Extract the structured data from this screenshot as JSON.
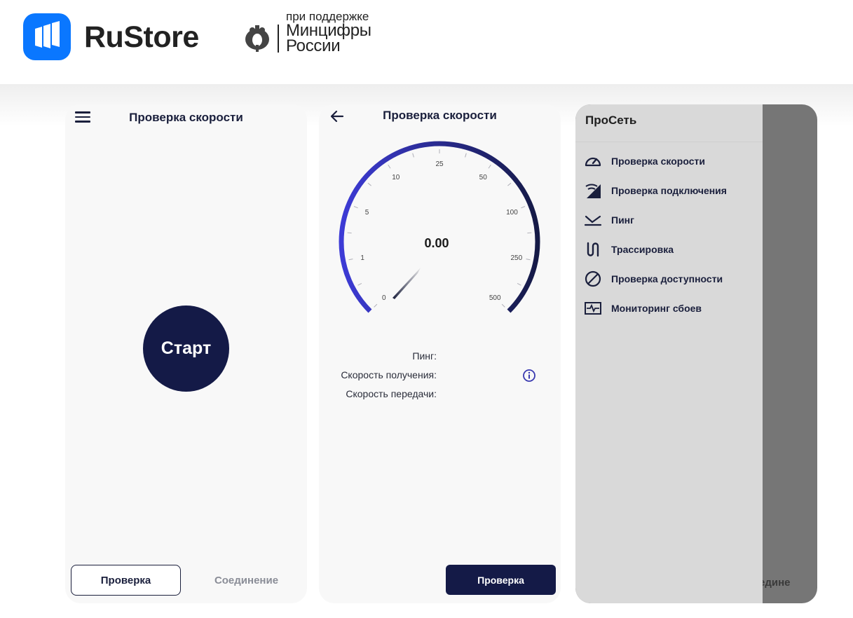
{
  "header": {
    "brand": "RuStore",
    "support_line": "при поддержке",
    "ministry_line1": "Минцифры",
    "ministry_line2": "России",
    "colors": {
      "brand_blue": "#0a77ff",
      "navy": "#141a47"
    }
  },
  "screen1": {
    "menu_icon": "hamburger-menu-icon",
    "title": "Проверка скорости",
    "start_label": "Старт",
    "tabs": [
      {
        "label": "Проверка",
        "active": true
      },
      {
        "label": "Соединение",
        "active": false
      }
    ]
  },
  "screen2": {
    "back_icon": "arrow-left-icon",
    "title": "Проверка скорости",
    "gauge": {
      "value_text": "0.00",
      "scale_labels": [
        "0",
        "1",
        "5",
        "10",
        "25",
        "50",
        "100",
        "250",
        "500"
      ]
    },
    "metrics": {
      "ping_label": "Пинг:",
      "download_label": "Скорость получения:",
      "upload_label": "Скорость передачи:"
    },
    "info_icon": "info-icon",
    "button_label": "Проверка"
  },
  "screen3": {
    "drawer_title": "ПроСеть",
    "menu": [
      {
        "icon": "speedometer-icon",
        "label": "Проверка скорости"
      },
      {
        "icon": "signal-icon",
        "label": "Проверка подключения"
      },
      {
        "icon": "ping-icon",
        "label": "Пинг"
      },
      {
        "icon": "route-icon",
        "label": "Трассировка"
      },
      {
        "icon": "block-icon",
        "label": "Проверка доступности"
      },
      {
        "icon": "monitoring-icon",
        "label": "Мониторинг сбоев"
      }
    ],
    "background_tab_fragment": "Соединение"
  }
}
